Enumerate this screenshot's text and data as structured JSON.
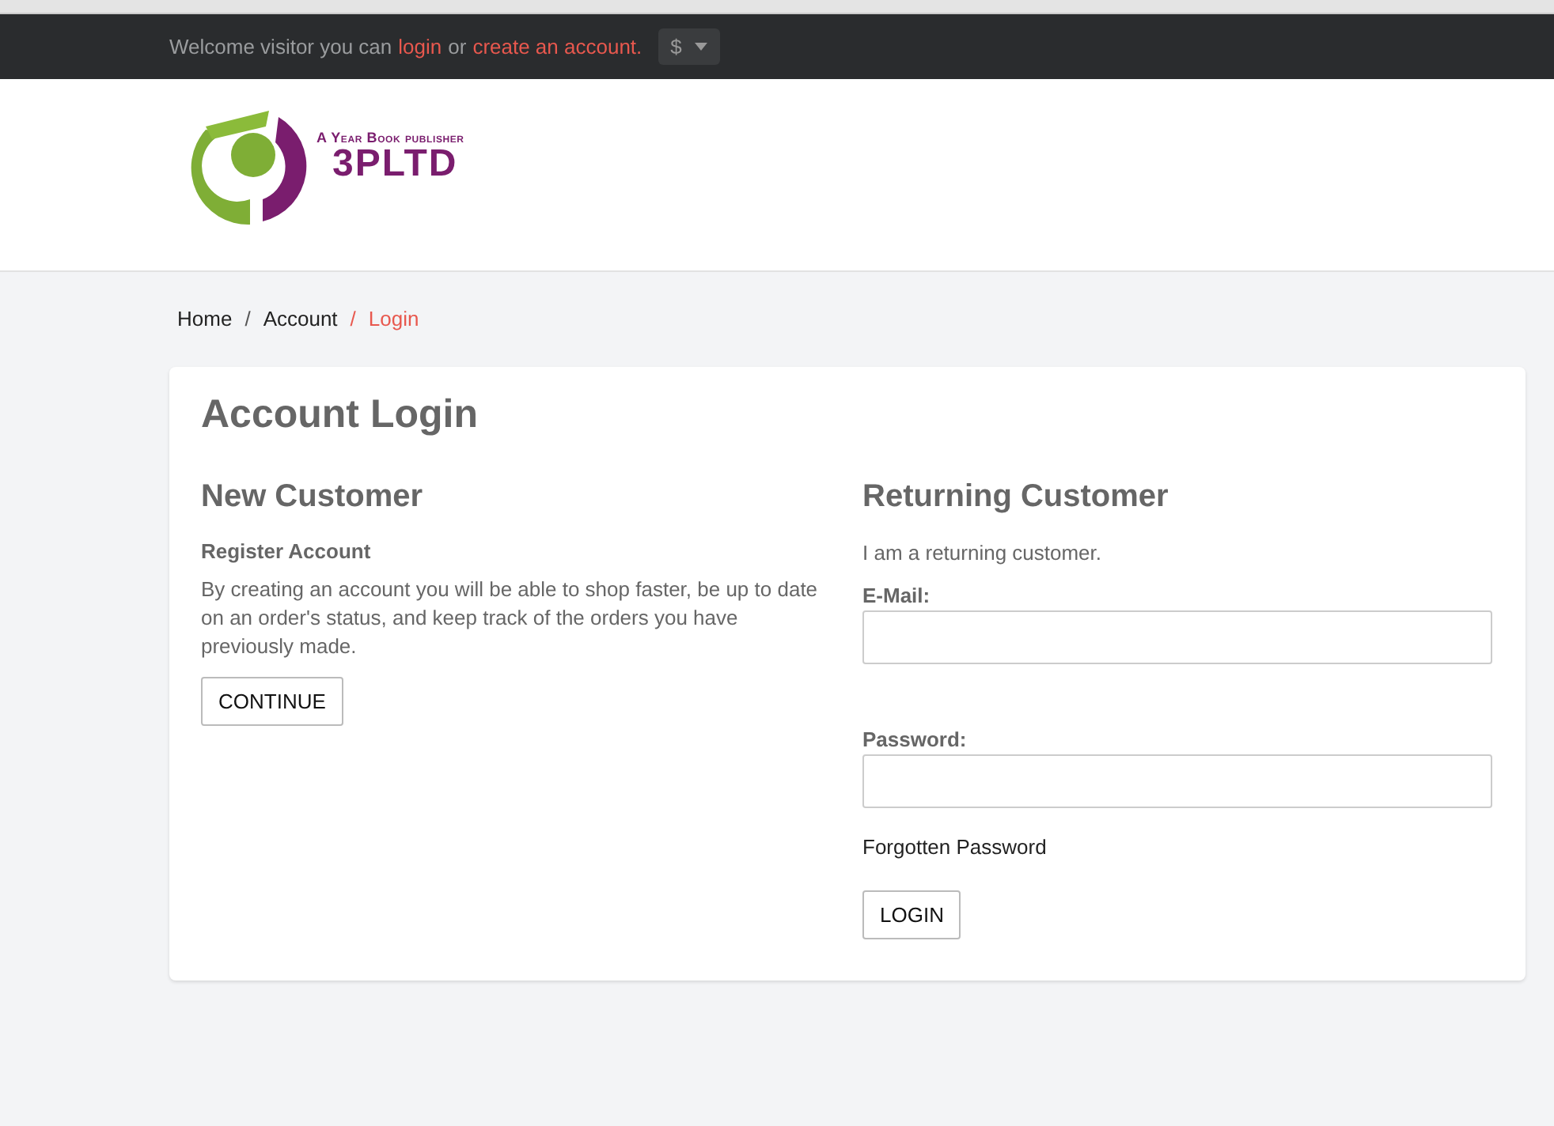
{
  "top_bar": {
    "welcome_text": "Welcome visitor you can",
    "login_link": "login",
    "or_text": "or",
    "create_account_link": "create an account.",
    "currency": "$"
  },
  "logo": {
    "tagline": "A Year Book publisher",
    "name": "3PLTD"
  },
  "breadcrumb": [
    {
      "label": "Home",
      "selected": false
    },
    {
      "separator": "/",
      "label": "Account",
      "selected": false
    },
    {
      "separator": "/",
      "label": "Login",
      "selected": true
    }
  ],
  "page_title": "Account Login",
  "new_customer": {
    "heading": "New Customer",
    "subheading": "Register Account",
    "text": "By creating an account you will be able to shop faster, be up to date on an order's status, and keep track of the orders you have previously made.",
    "button": "CONTINUE"
  },
  "returning_customer": {
    "heading": "Returning Customer",
    "text": "I am a returning customer.",
    "fields": [
      {
        "label": "E-Mail:"
      },
      {
        "label": "Password:"
      }
    ],
    "forgotten_link": "Forgotten Password",
    "button": "LOGIN"
  }
}
